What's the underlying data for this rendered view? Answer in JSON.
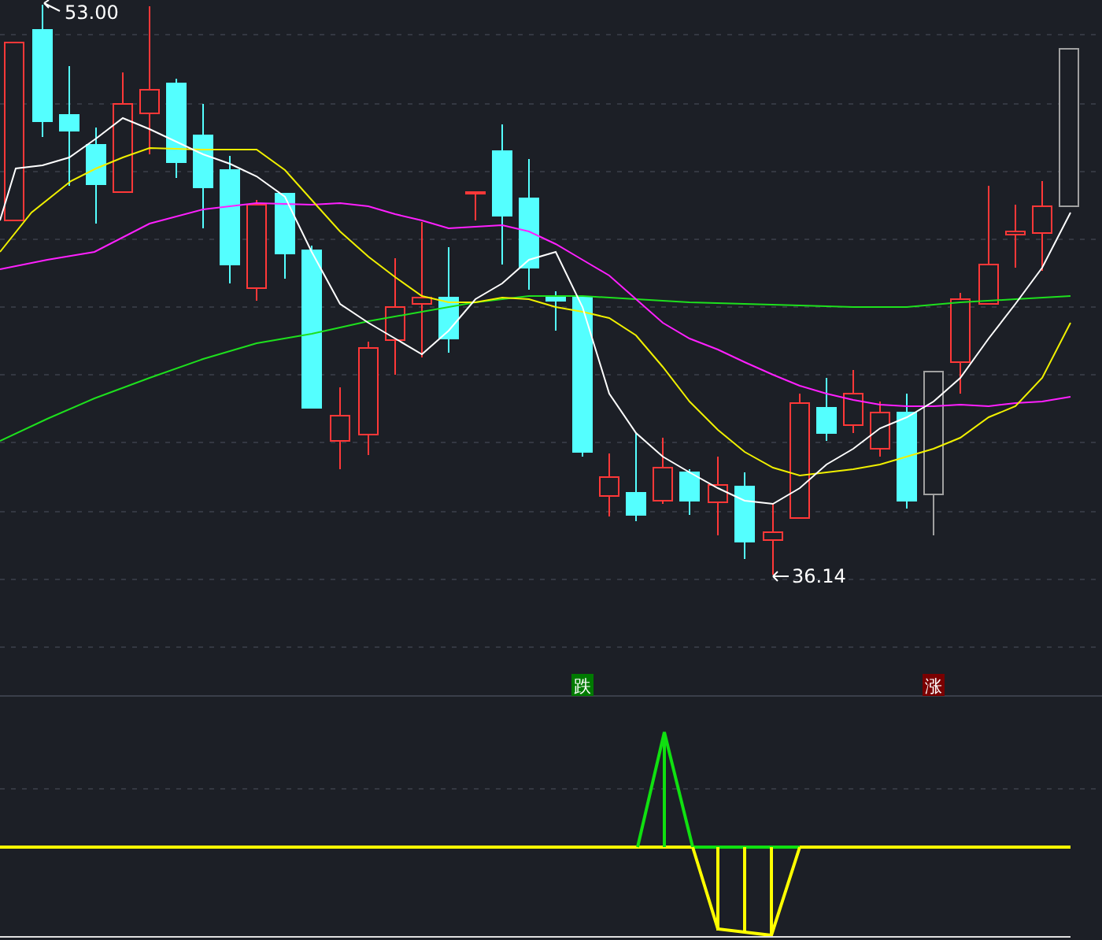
{
  "price_chart": {
    "high_label": "53.00",
    "low_label": "36.14"
  },
  "signals": [
    {
      "text": "跌",
      "kind": "fall"
    },
    {
      "text": "涨",
      "kind": "rise"
    }
  ]
}
